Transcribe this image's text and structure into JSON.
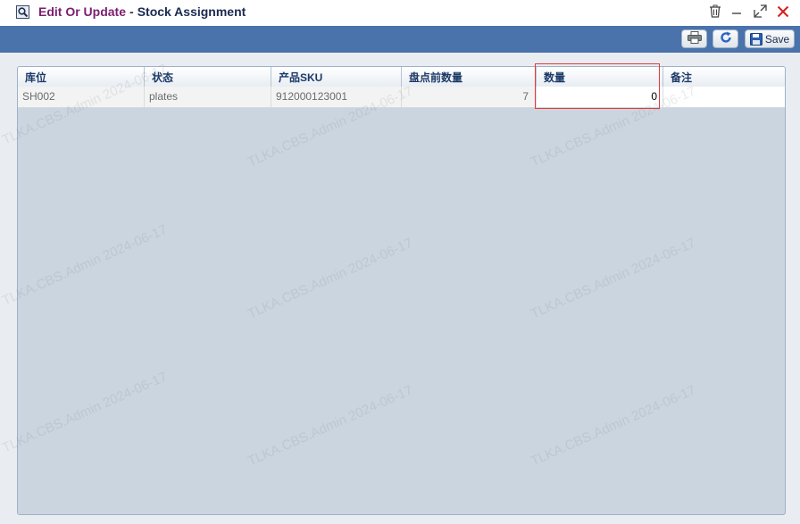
{
  "window": {
    "title_primary": "Edit Or Update",
    "title_separator": "-",
    "title_secondary": "Stock Assignment"
  },
  "icons": {
    "app": "search-icon",
    "delete": "trash-icon",
    "minimize": "minimize-icon",
    "maximize": "maximize-icon",
    "close": "close-icon",
    "print": "printer-icon",
    "refresh": "refresh-icon",
    "save": "floppy-disk-icon"
  },
  "toolbar": {
    "save_label": "Save"
  },
  "grid": {
    "columns": [
      "库位",
      "状态",
      "产品SKU",
      "盘点前数量",
      "数量",
      "备注"
    ],
    "rows": [
      {
        "location": "SH002",
        "status": "plates",
        "sku": "912000123001",
        "qty_before": "7",
        "qty": "0",
        "remark": ""
      }
    ]
  },
  "watermark": "TLKA.CBS.Admin 2024-06-17",
  "colors": {
    "title_primary": "#7a1f6e",
    "title_secondary": "#1a2a50",
    "toolbar_bg": "#4a72ab",
    "panel_bg": "#cbd5df",
    "close_icon": "#d42020",
    "highlight_border": "#e23a3a"
  }
}
